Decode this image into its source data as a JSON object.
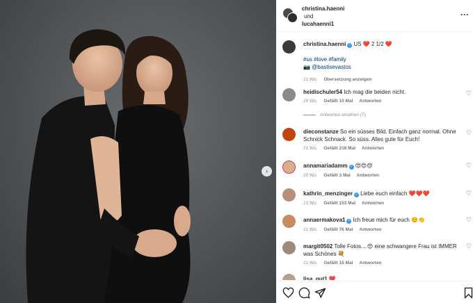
{
  "header": {
    "user1": "christina.haenni",
    "conj": "und",
    "user2": "lucahaenni1",
    "more_icon": "more-icon"
  },
  "caption": {
    "username": "christina.haenni",
    "text": "US ❤️ 2 1/2 ❤️",
    "hashtags": "#us #love #family",
    "credit": "📷 @bastisevastos",
    "time": "21 Wo.",
    "translate": "Übersetzung anzeigen"
  },
  "comments": [
    {
      "username": "heidischuler54",
      "text": "Ich mag die beiden nicht.",
      "time": "20 Wo.",
      "likes": "Gefällt 10 Mal",
      "reply": "Antworten",
      "view_replies": "Antworten ansehen (7)",
      "avatar_color": "#8a8a8a"
    },
    {
      "username": "dieconstanze",
      "text": "So ein süsses Bild. Einfach ganz normal. Ohne Schnick Schnack. So süss. Alles gute für Euch!",
      "time": "21 Wo.",
      "likes": "Gefällt 216 Mal",
      "reply": "Antworten",
      "avatar_color": "#c1440e"
    },
    {
      "username": "annamariadamm",
      "text": "😍😍😍",
      "time": "20 Wo.",
      "likes": "Gefällt 3 Mal",
      "reply": "Antworten",
      "avatar_color": "#d6b08a"
    },
    {
      "username": "kathrin_menzinger",
      "text": "Liebe euch einfach ❤️❤️❤️",
      "time": "21 Wo.",
      "likes": "Gefällt 153 Mal",
      "reply": "Antworten",
      "avatar_color": "#b78f7a"
    },
    {
      "username": "annaermakova1",
      "text": "Ich freue mich für euch ☺️👏",
      "time": "21 Wo.",
      "likes": "Gefällt 76 Mal",
      "reply": "Antworten",
      "avatar_color": "#c98b60"
    },
    {
      "username": "margit0502",
      "text": "Tolle Fotos....😍 eine schwangere Frau ist IMMER was Schönes 💐",
      "time": "21 Wo.",
      "likes": "Gefällt 15 Mal",
      "reply": "Antworten",
      "avatar_color": "#9c8a7c"
    },
    {
      "username": "lisa_gut1",
      "text": "❤️",
      "avatar_color": "#b5a08e"
    }
  ],
  "colors": {
    "link": "#00376b",
    "muted": "#8e8e8e",
    "verified": "#3897f0",
    "heart": "#e0245e"
  }
}
